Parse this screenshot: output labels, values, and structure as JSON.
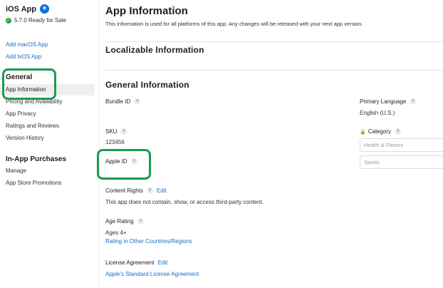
{
  "sidebar": {
    "app_name": "iOS App",
    "status": "5.7.0 Ready for Sale",
    "links": [
      "Add macOS App",
      "Add tvOS App"
    ],
    "general_heading": "General",
    "general_items": [
      "App Information",
      "Pricing and Availability",
      "App Privacy",
      "Ratings and Reviews",
      "Version History"
    ],
    "active_item": "App Information",
    "iap_heading": "In-App Purchases",
    "iap_items": [
      "Manage",
      "App Store Promotions"
    ]
  },
  "main": {
    "title": "App Information",
    "subtitle": "This information is used for all platforms of this app. Any changes will be released with your next app version.",
    "localizable_heading": "Localizable Information",
    "general_heading": "General Information",
    "bundle_id_label": "Bundle ID",
    "sku_label": "SKU",
    "sku_value": "123456",
    "apple_id_label": "Apple ID",
    "content_rights_label": "Content Rights",
    "content_rights_edit": "Edit",
    "content_rights_value": "This app does not contain, show, or access third-party content.",
    "age_rating_label": "Age Rating",
    "age_rating_value": "Ages 4+",
    "age_rating_link": "Rating in Other Countries/Regions",
    "license_label": "License Agreement",
    "license_edit": "Edit",
    "license_link": "Apple's Standard License Agreement",
    "primary_language_label": "Primary Language",
    "primary_language_value": "English (U.S.)",
    "category_label": "Category",
    "category_primary_placeholder": "Health & Fitness",
    "category_secondary_placeholder": "Sports",
    "help_glyph": "?",
    "plus_glyph": "+",
    "check_glyph": "✓",
    "lock_glyph": "🔒"
  },
  "colors": {
    "accent": "#1a6bc9",
    "highlight": "#1a9b55",
    "ready": "#27a844"
  }
}
